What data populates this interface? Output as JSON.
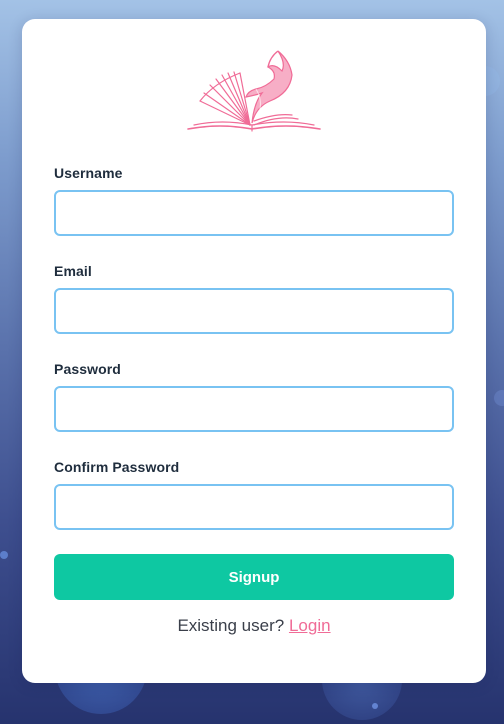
{
  "form": {
    "username_label": "Username",
    "username_value": "",
    "email_label": "Email",
    "email_value": "",
    "password_label": "Password",
    "password_value": "",
    "confirm_password_label": "Confirm Password",
    "confirm_password_value": "",
    "submit_label": "Signup"
  },
  "footer": {
    "prompt": "Existing user?",
    "link_label": "Login"
  },
  "icons": {
    "logo": "book-whale-logo-icon"
  },
  "colors": {
    "accent_button": "#0ec8a2",
    "input_border": "#79c3f2",
    "link": "#f06c97",
    "logo": "#f06c97"
  }
}
